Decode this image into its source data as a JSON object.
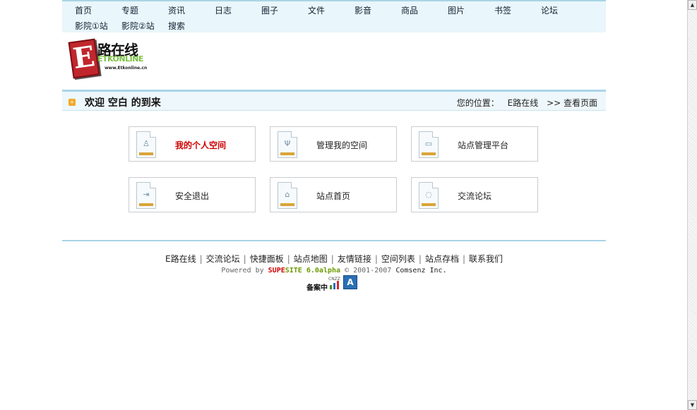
{
  "nav": {
    "items": [
      "首页",
      "专题",
      "资讯",
      "日志",
      "圈子",
      "文件",
      "影音",
      "商品",
      "图片",
      "书签",
      "论坛",
      "影院①站",
      "影院②站",
      "搜索"
    ]
  },
  "logo": {
    "cn": "路在线",
    "en": "ETKONLINE",
    "url": "www.Etkonline.cn"
  },
  "welcome": {
    "text": "欢迎 空白 的到来",
    "location_label": "您的位置：",
    "crumb_site": "E路在线",
    "crumb_page": ">> 查看页面"
  },
  "actions": [
    {
      "label": "我的个人空间",
      "icon": "person-icon",
      "highlight": true
    },
    {
      "label": "管理我的空间",
      "icon": "wrench-icon",
      "highlight": false
    },
    {
      "label": "站点管理平台",
      "icon": "panel-icon",
      "highlight": false
    },
    {
      "label": "安全退出",
      "icon": "exit-icon",
      "highlight": false
    },
    {
      "label": "站点首页",
      "icon": "home-icon",
      "highlight": false
    },
    {
      "label": "交流论坛",
      "icon": "chat-bubble-icon",
      "highlight": false
    }
  ],
  "footer": {
    "links": [
      "E路在线",
      "交流论坛",
      "快捷面板",
      "站点地图",
      "友情链接",
      "空间列表",
      "站点存档",
      "联系我们"
    ],
    "powered_prefix": "Powered by",
    "brand_a": "SUPE",
    "brand_b": "SITE",
    "version": "6.0alpha",
    "copyright": "© 2001-2007",
    "company": "Comsenz Inc.",
    "beian": "备案中",
    "cnzz": "CNZZ"
  },
  "colors": {
    "accent_blue": "#a9d4e6",
    "hot_red": "#cc0000",
    "icon_strip": "#d9a437"
  }
}
